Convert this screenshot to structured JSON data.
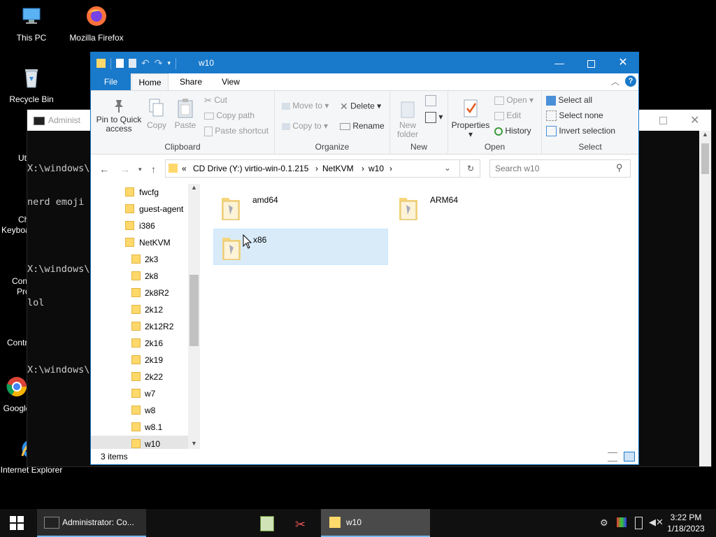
{
  "desktop": {
    "icons": [
      {
        "label": "This PC",
        "icon": "this-pc-icon"
      },
      {
        "label": "Mozilla Firefox",
        "icon": "firefox-icon"
      },
      {
        "label": "Recycle Bin",
        "icon": "recycle-bin-icon"
      },
      {
        "label": "Google",
        "icon": "chrome-icon"
      },
      {
        "label": "Internet Explorer",
        "icon": "ie-icon"
      }
    ],
    "partial_labels": [
      "Ut",
      "Ch",
      "Keyboa",
      "Con",
      "Pro",
      "Contr"
    ]
  },
  "console": {
    "title": "Administ",
    "lines": [
      "X:\\windows\\S",
      "nerd emoji",
      "",
      "X:\\windows\\S",
      "lol",
      "",
      "X:\\windows\\S"
    ]
  },
  "explorer": {
    "title": "w10",
    "tabs": [
      "File",
      "Home",
      "Share",
      "View"
    ],
    "active_tab": "Home",
    "ribbon": {
      "clipboard": {
        "label": "Clipboard",
        "pin": "Pin to Quick access",
        "pin_l1": "Pin to Quick",
        "pin_l2": "access",
        "copy": "Copy",
        "paste": "Paste",
        "cut": "Cut",
        "copy_path": "Copy path",
        "paste_shortcut": "Paste shortcut"
      },
      "organize": {
        "label": "Organize",
        "move_to": "Move to",
        "copy_to": "Copy to",
        "delete": "Delete",
        "rename": "Rename"
      },
      "new": {
        "label": "New",
        "new_folder_l1": "New",
        "new_folder_l2": "folder"
      },
      "open": {
        "label": "Open",
        "properties": "Properties",
        "open": "Open",
        "edit": "Edit",
        "history": "History"
      },
      "select": {
        "label": "Select",
        "select_all": "Select all",
        "select_none": "Select none",
        "invert": "Invert selection"
      }
    },
    "address": {
      "prefix": "«",
      "crumbs": [
        "CD Drive (Y:) virtio-win-0.1.215",
        "NetKVM",
        "w10"
      ]
    },
    "search_placeholder": "Search w10",
    "nav_tree": [
      {
        "label": "fwcfg",
        "indent": 0
      },
      {
        "label": "guest-agent",
        "indent": 0
      },
      {
        "label": "i386",
        "indent": 0
      },
      {
        "label": "NetKVM",
        "indent": 0
      },
      {
        "label": "2k3",
        "indent": 1
      },
      {
        "label": "2k8",
        "indent": 1
      },
      {
        "label": "2k8R2",
        "indent": 1
      },
      {
        "label": "2k12",
        "indent": 1
      },
      {
        "label": "2k12R2",
        "indent": 1
      },
      {
        "label": "2k16",
        "indent": 1
      },
      {
        "label": "2k19",
        "indent": 1
      },
      {
        "label": "2k22",
        "indent": 1
      },
      {
        "label": "w7",
        "indent": 1
      },
      {
        "label": "w8",
        "indent": 1
      },
      {
        "label": "w8.1",
        "indent": 1
      },
      {
        "label": "w10",
        "indent": 1,
        "selected": true
      }
    ],
    "items": [
      {
        "name": "amd64"
      },
      {
        "name": "ARM64"
      },
      {
        "name": "x86",
        "selected": true
      }
    ],
    "status": "3 items"
  },
  "taskbar": {
    "console_task": "Administrator: Co...",
    "explorer_task": "w10",
    "time": "3:22 PM",
    "date": "1/18/2023"
  },
  "colors": {
    "accent": "#1979ca",
    "selection": "#d9ebf9",
    "taskbar": "#101010"
  }
}
